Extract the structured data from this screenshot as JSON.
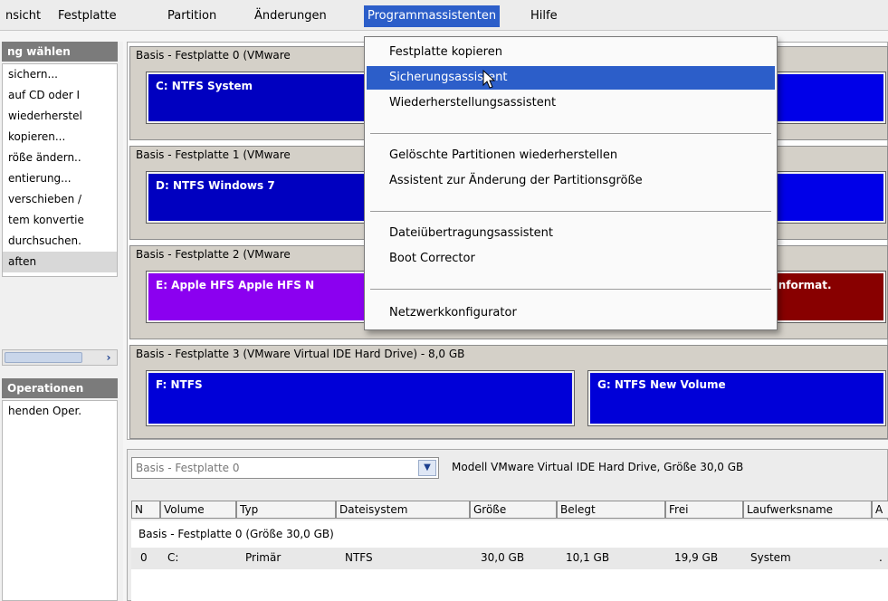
{
  "menubar": {
    "items": [
      "nsicht",
      "Festplatte",
      "Partition",
      "Änderungen",
      "Programmassistenten",
      "Hilfe"
    ],
    "active": "Programmassistenten"
  },
  "sidebar": {
    "section1_title": "ng wählen",
    "links": [
      "sichern...",
      "auf CD oder I",
      "wiederherstel",
      "kopieren...",
      "röße ändern..",
      "entierung...",
      "verschieben /",
      "tem konvertie",
      "durchsuchen.",
      "aften"
    ],
    "selected_link": "aften",
    "scroll_right_glyph": "›",
    "section2_title": "Operationen",
    "pending_text": "henden Oper."
  },
  "disks": [
    {
      "label": "Basis - Festplatte 0 (VMware",
      "partitions": [
        {
          "text": "C: NTFS System"
        }
      ]
    },
    {
      "label": "Basis - Festplatte 1 (VMware",
      "partitions": [
        {
          "text": "D: NTFS Windows 7"
        }
      ]
    },
    {
      "label": "Basis - Festplatte 2 (VMware",
      "partitions": [
        {
          "text": "E: Apple HFS Apple HFS N"
        },
        {
          "text": "Unformat."
        }
      ]
    },
    {
      "label": "Basis - Festplatte 3 (VMware Virtual IDE Hard Drive) - 8,0 GB",
      "partitions": [
        {
          "text": "F: NTFS"
        },
        {
          "text": "G: NTFS New Volume"
        }
      ]
    }
  ],
  "dropdown": {
    "items": [
      "Festplatte kopieren",
      "Sicherungsassistent",
      "Wiederherstellungsassistent",
      "Gelöschte Partitionen wiederherstellen",
      "Assistent zur Änderung der Partitionsgröße",
      "Dateiübertragungsassistent",
      "Boot Corrector",
      "Netzwerkkonfigurator"
    ],
    "highlighted": "Sicherungsassistent"
  },
  "bottom": {
    "disk_select_value": "Basis - Festplatte 0",
    "model_info": "Modell VMware Virtual IDE Hard Drive, Größe 30,0 GB",
    "columns": [
      "N",
      "Volume",
      "Typ",
      "Dateisystem",
      "Größe",
      "Belegt",
      "Frei",
      "Laufwerksname",
      "A"
    ],
    "group_label": "Basis - Festplatte 0 (Größe 30,0 GB)",
    "row": {
      "n": "0",
      "volume": "C:",
      "typ": "Primär",
      "dateisystem": "NTFS",
      "groesse": "30,0 GB",
      "belegt": "10,1 GB",
      "frei": "19,9 GB",
      "laufwerksname": "System",
      "a": "."
    }
  },
  "colors": {
    "accent": "#2c5ec9",
    "ntfs": "#0000d8",
    "hfs": "#8b00f0",
    "unformatted": "#880000"
  }
}
